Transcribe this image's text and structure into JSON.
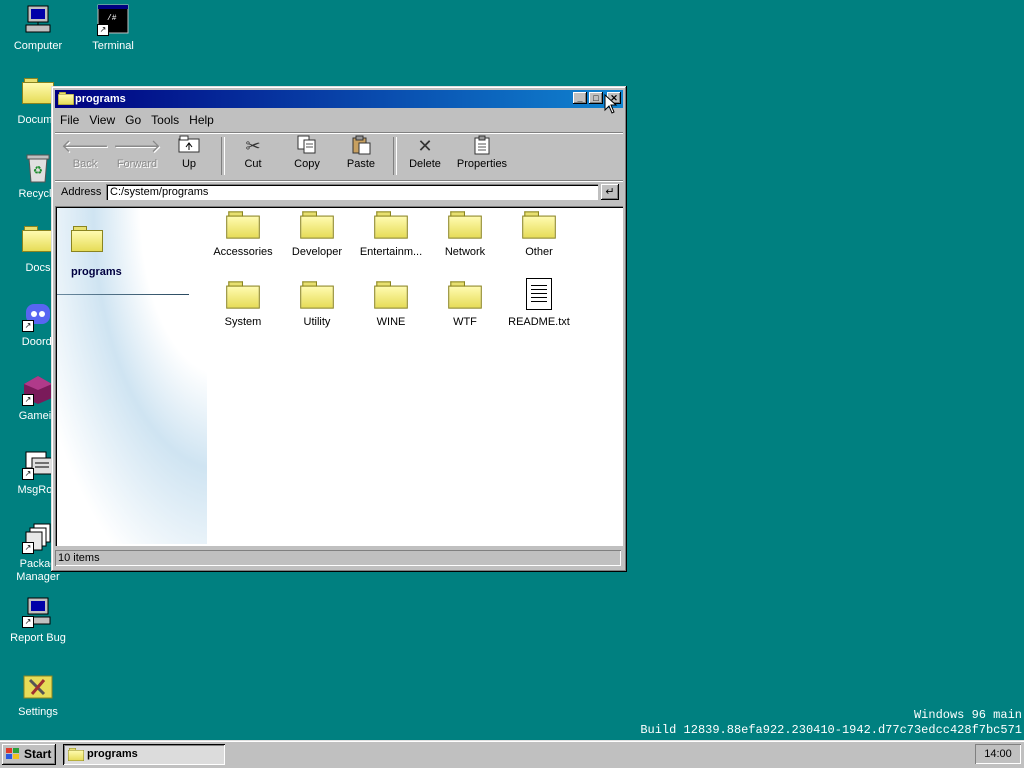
{
  "desktop": {
    "icons": [
      {
        "label": "Computer"
      },
      {
        "label": "Terminal"
      },
      {
        "label": "Docume"
      },
      {
        "label": "Recycle"
      },
      {
        "label": "Docs"
      },
      {
        "label": "Doordi"
      },
      {
        "label": "Gamein"
      },
      {
        "label": "MsgRoo"
      },
      {
        "label": "Packag Manager"
      },
      {
        "label": "Report Bug"
      },
      {
        "label": "Settings"
      }
    ]
  },
  "window": {
    "title": "programs",
    "menu": [
      "File",
      "View",
      "Go",
      "Tools",
      "Help"
    ],
    "toolbar": {
      "back": "Back",
      "forward": "Forward",
      "up": "Up",
      "cut": "Cut",
      "copy": "Copy",
      "paste": "Paste",
      "delete": "Delete",
      "properties": "Properties"
    },
    "address": {
      "label": "Address",
      "value": "C:/system/programs"
    },
    "sidepanel_title": "programs",
    "items": [
      {
        "label": "Accessories",
        "type": "folder"
      },
      {
        "label": "Developer",
        "type": "folder"
      },
      {
        "label": "Entertainm...",
        "type": "folder"
      },
      {
        "label": "Network",
        "type": "folder"
      },
      {
        "label": "Other",
        "type": "folder"
      },
      {
        "label": "System",
        "type": "folder"
      },
      {
        "label": "Utility",
        "type": "folder"
      },
      {
        "label": "WINE",
        "type": "folder"
      },
      {
        "label": "WTF",
        "type": "folder"
      },
      {
        "label": "README.txt",
        "type": "text-file"
      }
    ],
    "status": "10 items"
  },
  "taskbar": {
    "start_label": "Start",
    "task_label": "programs",
    "clock": "14:00"
  },
  "build": {
    "line1": "Windows 96 main",
    "line2": "Build 12839.88efa922.230410-1942.d77c73edcc428f7bc571"
  },
  "colors": {
    "desktop": "#008080",
    "titlebar_start": "#000080",
    "titlebar_end": "#1084d0"
  }
}
